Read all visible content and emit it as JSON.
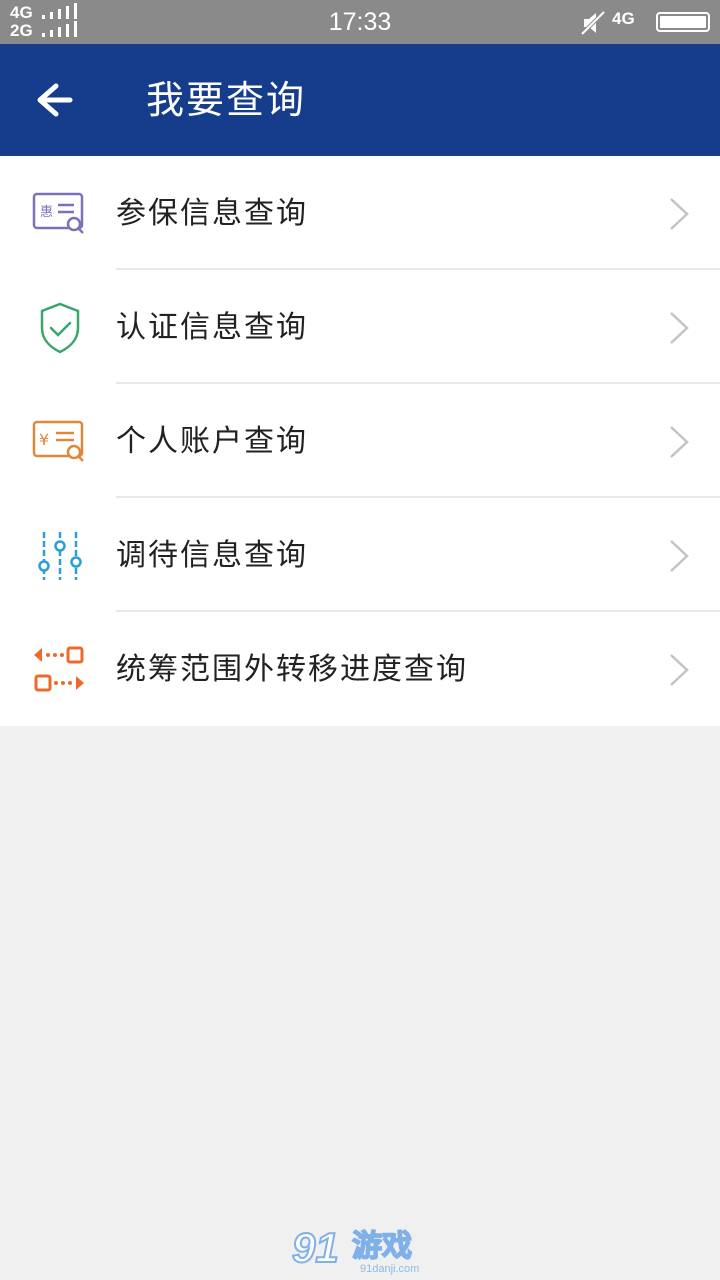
{
  "status_bar": {
    "network_1": "4G",
    "network_2": "2G",
    "time": "17:33",
    "network_right": "4G"
  },
  "header": {
    "title": "我要查询",
    "background_color": "#163d8c"
  },
  "menu": {
    "items": [
      {
        "label": "参保信息查询",
        "icon": "insured-info-search-icon",
        "color": "#7b73b8"
      },
      {
        "label": "认证信息查询",
        "icon": "shield-check-icon",
        "color": "#3aa66b"
      },
      {
        "label": "个人账户查询",
        "icon": "yuan-account-search-icon",
        "color": "#e0873a"
      },
      {
        "label": "调待信息查询",
        "icon": "sliders-icon",
        "color": "#2a9fd6"
      },
      {
        "label": "统筹范围外转移进度查询",
        "icon": "transfer-icon",
        "color": "#ef6a2a"
      }
    ]
  },
  "watermark": {
    "brand_number": "91",
    "brand_name": "游戏",
    "site": "91danji.com"
  }
}
